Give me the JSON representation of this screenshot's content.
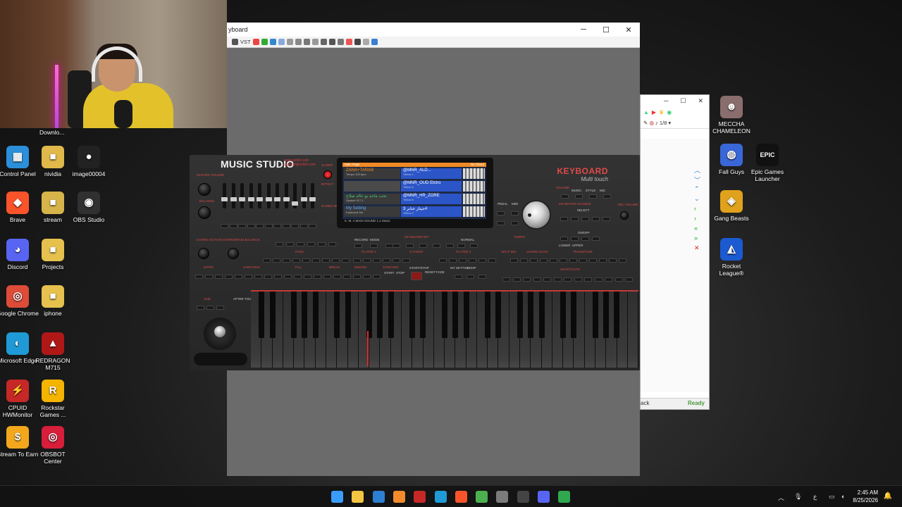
{
  "desktop": {
    "partial_label": "Downlo...",
    "icons_left": [
      {
        "id": "control-panel",
        "label": "Control Panel",
        "color": "#2b8fd9",
        "glyph": "▦"
      },
      {
        "id": "nvidia",
        "label": "nividia",
        "color": "#e0b94a",
        "glyph": "■"
      },
      {
        "id": "image00004",
        "label": "image00004",
        "color": "#222222",
        "glyph": "●"
      },
      {
        "id": "brave",
        "label": "Brave",
        "color": "#fb542b",
        "glyph": "◆"
      },
      {
        "id": "stream",
        "label": "stream",
        "color": "#d6b44a",
        "glyph": "■"
      },
      {
        "id": "obs-studio",
        "label": "OBS Studio",
        "color": "#303030",
        "glyph": "◉"
      },
      {
        "id": "discord",
        "label": "Discord",
        "color": "#5865f2",
        "glyph": "◕"
      },
      {
        "id": "projects",
        "label": "Projects",
        "color": "#e6c14d",
        "glyph": "■"
      },
      {
        "id": "google-chrome",
        "label": "Google Chrome",
        "color": "#dd4b39",
        "glyph": "◎"
      },
      {
        "id": "iphone",
        "label": "iphone",
        "color": "#e6c14d",
        "glyph": "■"
      },
      {
        "id": "microsoft-edge",
        "label": "Microsoft Edge",
        "color": "#1f9ad6",
        "glyph": "◐"
      },
      {
        "id": "redragon",
        "label": "REDRAGON M715",
        "color": "#b01818",
        "glyph": "▲"
      },
      {
        "id": "cpuid",
        "label": "CPUID HWMonitor",
        "color": "#c62828",
        "glyph": "⚡"
      },
      {
        "id": "rockstar",
        "label": "Rockstar Games ...",
        "color": "#f4b400",
        "glyph": "R"
      },
      {
        "id": "stream-to-earn",
        "label": "Stream To Earn",
        "color": "#f3a81c",
        "glyph": "$"
      },
      {
        "id": "obsbot",
        "label": "OBSBOT Center",
        "color": "#d71e3a",
        "glyph": "◎"
      }
    ],
    "icons_right": [
      {
        "id": "meccha-chameleon",
        "label": "MECCHA CHAMELEON",
        "color": "#8a6d6d",
        "glyph": "☻"
      },
      {
        "id": "fall-guys",
        "label": "Fall Guys",
        "color": "#3a67d8",
        "glyph": "◍"
      },
      {
        "id": "epic-games",
        "label": "Epic Games Launcher",
        "color": "#111111",
        "glyph": "EPIC"
      },
      {
        "id": "gang-beasts",
        "label": "Gang Beasts",
        "color": "#e0a21c",
        "glyph": "◈"
      },
      {
        "id": "rocket-league",
        "label": "Rocket League®",
        "color": "#1b5ad0",
        "glyph": "◭"
      }
    ]
  },
  "main_window": {
    "title": "yboard",
    "toolbar_text": "VST"
  },
  "keyboard": {
    "brand": "MUSIC STUDIO",
    "brand_sub1": "www.sofeh.com",
    "brand_sub2": "support@sofeh.com",
    "logo": "KEYBOARD",
    "logo_sub": "Multi touch",
    "screen": {
      "header_left": "Main Page",
      "header_right": "No Chord",
      "rows": [
        {
          "left": "ZANA+TARAB",
          "left_sub": "Tempo 100 bpm",
          "right": "@MNR_ALD...",
          "right_sub": "Yellow 1"
        },
        {
          "left": "",
          "left_sub": "",
          "right": "@MNR_OUD Elctro",
          "right_sub": "Yellow 3"
        },
        {
          "left": "تخت ماجد يو خالد صلاح",
          "left_sub": "System 017.1",
          "right": "@MNR_HR_ZORE",
          "right_sub": "Yellow 8"
        },
        {
          "left": "My Setting",
          "left_sub": "Keyboard Set",
          "right": "جيتار عنابر 3#",
          "right_sub": "Yellow 2"
        }
      ],
      "footer": "K. M. A   MAIN   SOUND 1.1 Music"
    },
    "labels": {
      "master_volume": "MASTER VOLUME",
      "balance": "BALANCE",
      "chord_octave": "CHORD OCTAVE",
      "chord_drum_balance": "CHORD/DRUM BALANCE",
      "slider": "SLIDER",
      "effect": "EFFECT",
      "slider_mode": "SLIDER MODE",
      "keyboard_set": "KEYBOARD SET",
      "record": "RECORD",
      "mode": "MODE",
      "normal": "NORMAL",
      "pads": "PADS",
      "player_1": "PLAYER 1",
      "player_2": "PLAYER 2",
      "x_fader": "X-FADER",
      "intro": "INTRO",
      "variation": "VARIATION",
      "fill": "FILL",
      "break": "BREAK",
      "ending": "ENDING",
      "synchro": "SYNCHRO",
      "start": "START",
      "stop": "STOP",
      "start_stop": "START/STOP",
      "reset": "RESET",
      "fade": "FADE",
      "my_setting": "MY SETTING",
      "loop": "LOOP",
      "keyboard_sounds": "KEYBOARD SOUNDS",
      "select": "SELECT",
      "tempo": "TEMPO",
      "pedal": "PEDAL",
      "midi": "MIDI",
      "volume": "VOLUME",
      "music": "MUSIC",
      "style": "STYLE",
      "mic": "MIC",
      "mic_volume": "MIC VOLUME",
      "on_off": "ON/OFF",
      "lower": "LOWER",
      "upper": "UPPER",
      "chord_scan": "CHORD SCAN",
      "transpose": "TRANSPOSE",
      "shortcuts": "SHORTCUTS",
      "split_mix": "SPLIT MIX",
      "after_touch": "AFTER TOUCH",
      "one": "ONE"
    }
  },
  "side_window": {
    "toolbar_value": "1/8",
    "status_left": "ack",
    "status_right": "Ready"
  },
  "taskbar": {
    "time": "2:45 AM",
    "date": "8/25/2026",
    "lang": "ع",
    "icons": [
      {
        "id": "start",
        "color": "#3b9cff"
      },
      {
        "id": "file-explorer",
        "color": "#f4c542"
      },
      {
        "id": "store",
        "color": "#2d7fd1"
      },
      {
        "id": "app-3",
        "color": "#f28b2b"
      },
      {
        "id": "app-mister",
        "color": "#c62828"
      },
      {
        "id": "edge",
        "color": "#1f9ad6"
      },
      {
        "id": "brave",
        "color": "#fb542b"
      },
      {
        "id": "chrome",
        "color": "#4caf50"
      },
      {
        "id": "camera",
        "color": "#7b7b7b"
      },
      {
        "id": "app-redbadge",
        "color": "#444444"
      },
      {
        "id": "discord",
        "color": "#5865f2"
      },
      {
        "id": "keyboard-app",
        "color": "#2fa84f"
      }
    ]
  }
}
